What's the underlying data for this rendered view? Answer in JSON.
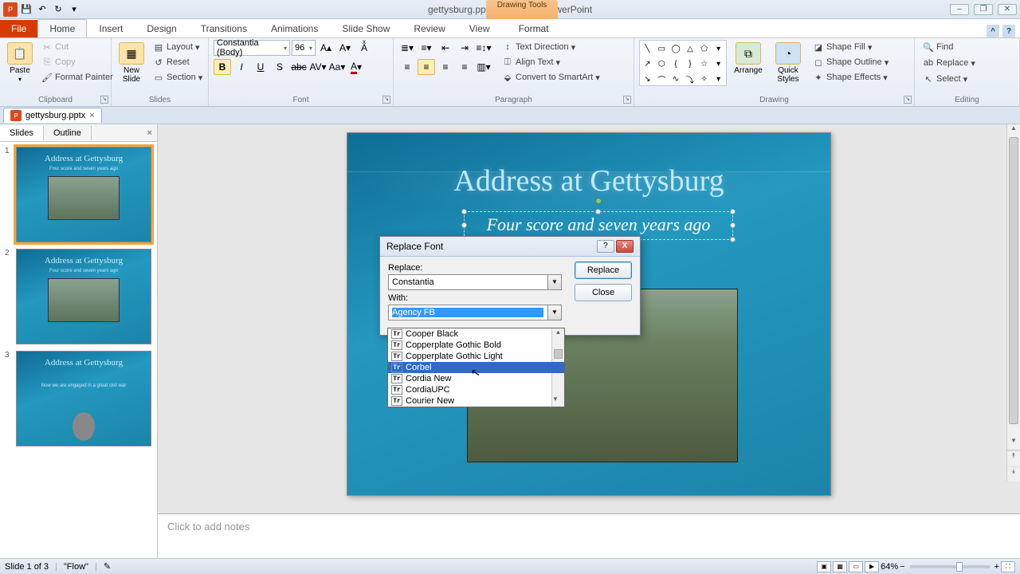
{
  "app": {
    "title": "gettysburg.pptx - Microsoft PowerPoint",
    "contextual_tab_group": "Drawing Tools",
    "contextual_tab": "Format"
  },
  "qat": {
    "save": "💾",
    "undo": "↶",
    "redo": "↻"
  },
  "tabs": {
    "file": "File",
    "items": [
      "Home",
      "Insert",
      "Design",
      "Transitions",
      "Animations",
      "Slide Show",
      "Review",
      "View"
    ],
    "active": "Home"
  },
  "ribbon": {
    "clipboard": {
      "label": "Clipboard",
      "paste": "Paste",
      "cut": "Cut",
      "copy": "Copy",
      "fmt": "Format Painter"
    },
    "slides": {
      "label": "Slides",
      "new": "New\nSlide",
      "layout": "Layout",
      "reset": "Reset",
      "section": "Section"
    },
    "font": {
      "label": "Font",
      "name": "Constantia (Body)",
      "size": "96",
      "bold": "B",
      "italic": "I",
      "underline": "U",
      "strike": "abc",
      "shadow": "S"
    },
    "paragraph": {
      "label": "Paragraph",
      "text_dir": "Text Direction",
      "align": "Align Text",
      "smartart": "Convert to SmartArt"
    },
    "drawing": {
      "label": "Drawing",
      "arrange": "Arrange",
      "quick": "Quick\nStyles",
      "fill": "Shape Fill",
      "outline": "Shape Outline",
      "effects": "Shape Effects"
    },
    "editing": {
      "label": "Editing",
      "find": "Find",
      "replace": "Replace",
      "select": "Select"
    }
  },
  "doctab": {
    "name": "gettysburg.pptx"
  },
  "sidepanel": {
    "tabs": [
      "Slides",
      "Outline"
    ],
    "active": "Slides",
    "slides": [
      {
        "n": "1",
        "title": "Address at Gettysburg",
        "sub": "Four score and seven years ago"
      },
      {
        "n": "2",
        "title": "Address at Gettysburg",
        "sub": "Four score and seven years ago"
      },
      {
        "n": "3",
        "title": "Address at Gettysburg",
        "sub": "Now we are engaged in a great civil war"
      }
    ]
  },
  "slide": {
    "title": "Address at Gettysburg",
    "subtitle": "Four score and seven years ago"
  },
  "notes": {
    "placeholder": "Click to add notes"
  },
  "status": {
    "slide": "Slide 1 of 3",
    "theme": "\"Flow\"",
    "zoom": "64%"
  },
  "dialog": {
    "title": "Replace Font",
    "replace_label": "Replace:",
    "replace_value": "Constantia",
    "with_label": "With:",
    "with_value": "Agency FB",
    "btn_replace": "Replace",
    "btn_close": "Close",
    "fonts": [
      "Cooper Black",
      "Copperplate Gothic Bold",
      "Copperplate Gothic Light",
      "Corbel",
      "Cordia New",
      "CordiaUPC",
      "Courier New"
    ],
    "hover_index": 3
  }
}
